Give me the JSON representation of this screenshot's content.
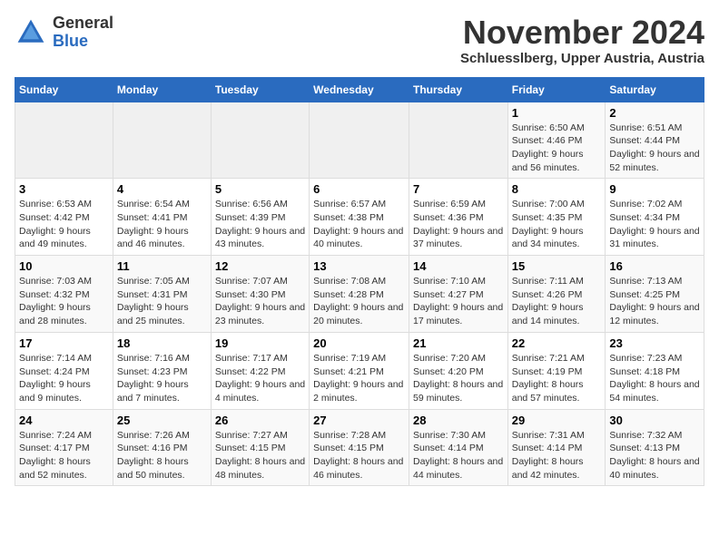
{
  "header": {
    "logo_general": "General",
    "logo_blue": "Blue",
    "month_title": "November 2024",
    "location": "Schluesslberg, Upper Austria, Austria"
  },
  "weekdays": [
    "Sunday",
    "Monday",
    "Tuesday",
    "Wednesday",
    "Thursday",
    "Friday",
    "Saturday"
  ],
  "weeks": [
    {
      "days": [
        {
          "number": "",
          "info": ""
        },
        {
          "number": "",
          "info": ""
        },
        {
          "number": "",
          "info": ""
        },
        {
          "number": "",
          "info": ""
        },
        {
          "number": "",
          "info": ""
        },
        {
          "number": "1",
          "info": "Sunrise: 6:50 AM\nSunset: 4:46 PM\nDaylight: 9 hours and 56 minutes."
        },
        {
          "number": "2",
          "info": "Sunrise: 6:51 AM\nSunset: 4:44 PM\nDaylight: 9 hours and 52 minutes."
        }
      ]
    },
    {
      "days": [
        {
          "number": "3",
          "info": "Sunrise: 6:53 AM\nSunset: 4:42 PM\nDaylight: 9 hours and 49 minutes."
        },
        {
          "number": "4",
          "info": "Sunrise: 6:54 AM\nSunset: 4:41 PM\nDaylight: 9 hours and 46 minutes."
        },
        {
          "number": "5",
          "info": "Sunrise: 6:56 AM\nSunset: 4:39 PM\nDaylight: 9 hours and 43 minutes."
        },
        {
          "number": "6",
          "info": "Sunrise: 6:57 AM\nSunset: 4:38 PM\nDaylight: 9 hours and 40 minutes."
        },
        {
          "number": "7",
          "info": "Sunrise: 6:59 AM\nSunset: 4:36 PM\nDaylight: 9 hours and 37 minutes."
        },
        {
          "number": "8",
          "info": "Sunrise: 7:00 AM\nSunset: 4:35 PM\nDaylight: 9 hours and 34 minutes."
        },
        {
          "number": "9",
          "info": "Sunrise: 7:02 AM\nSunset: 4:34 PM\nDaylight: 9 hours and 31 minutes."
        }
      ]
    },
    {
      "days": [
        {
          "number": "10",
          "info": "Sunrise: 7:03 AM\nSunset: 4:32 PM\nDaylight: 9 hours and 28 minutes."
        },
        {
          "number": "11",
          "info": "Sunrise: 7:05 AM\nSunset: 4:31 PM\nDaylight: 9 hours and 25 minutes."
        },
        {
          "number": "12",
          "info": "Sunrise: 7:07 AM\nSunset: 4:30 PM\nDaylight: 9 hours and 23 minutes."
        },
        {
          "number": "13",
          "info": "Sunrise: 7:08 AM\nSunset: 4:28 PM\nDaylight: 9 hours and 20 minutes."
        },
        {
          "number": "14",
          "info": "Sunrise: 7:10 AM\nSunset: 4:27 PM\nDaylight: 9 hours and 17 minutes."
        },
        {
          "number": "15",
          "info": "Sunrise: 7:11 AM\nSunset: 4:26 PM\nDaylight: 9 hours and 14 minutes."
        },
        {
          "number": "16",
          "info": "Sunrise: 7:13 AM\nSunset: 4:25 PM\nDaylight: 9 hours and 12 minutes."
        }
      ]
    },
    {
      "days": [
        {
          "number": "17",
          "info": "Sunrise: 7:14 AM\nSunset: 4:24 PM\nDaylight: 9 hours and 9 minutes."
        },
        {
          "number": "18",
          "info": "Sunrise: 7:16 AM\nSunset: 4:23 PM\nDaylight: 9 hours and 7 minutes."
        },
        {
          "number": "19",
          "info": "Sunrise: 7:17 AM\nSunset: 4:22 PM\nDaylight: 9 hours and 4 minutes."
        },
        {
          "number": "20",
          "info": "Sunrise: 7:19 AM\nSunset: 4:21 PM\nDaylight: 9 hours and 2 minutes."
        },
        {
          "number": "21",
          "info": "Sunrise: 7:20 AM\nSunset: 4:20 PM\nDaylight: 8 hours and 59 minutes."
        },
        {
          "number": "22",
          "info": "Sunrise: 7:21 AM\nSunset: 4:19 PM\nDaylight: 8 hours and 57 minutes."
        },
        {
          "number": "23",
          "info": "Sunrise: 7:23 AM\nSunset: 4:18 PM\nDaylight: 8 hours and 54 minutes."
        }
      ]
    },
    {
      "days": [
        {
          "number": "24",
          "info": "Sunrise: 7:24 AM\nSunset: 4:17 PM\nDaylight: 8 hours and 52 minutes."
        },
        {
          "number": "25",
          "info": "Sunrise: 7:26 AM\nSunset: 4:16 PM\nDaylight: 8 hours and 50 minutes."
        },
        {
          "number": "26",
          "info": "Sunrise: 7:27 AM\nSunset: 4:15 PM\nDaylight: 8 hours and 48 minutes."
        },
        {
          "number": "27",
          "info": "Sunrise: 7:28 AM\nSunset: 4:15 PM\nDaylight: 8 hours and 46 minutes."
        },
        {
          "number": "28",
          "info": "Sunrise: 7:30 AM\nSunset: 4:14 PM\nDaylight: 8 hours and 44 minutes."
        },
        {
          "number": "29",
          "info": "Sunrise: 7:31 AM\nSunset: 4:14 PM\nDaylight: 8 hours and 42 minutes."
        },
        {
          "number": "30",
          "info": "Sunrise: 7:32 AM\nSunset: 4:13 PM\nDaylight: 8 hours and 40 minutes."
        }
      ]
    }
  ]
}
